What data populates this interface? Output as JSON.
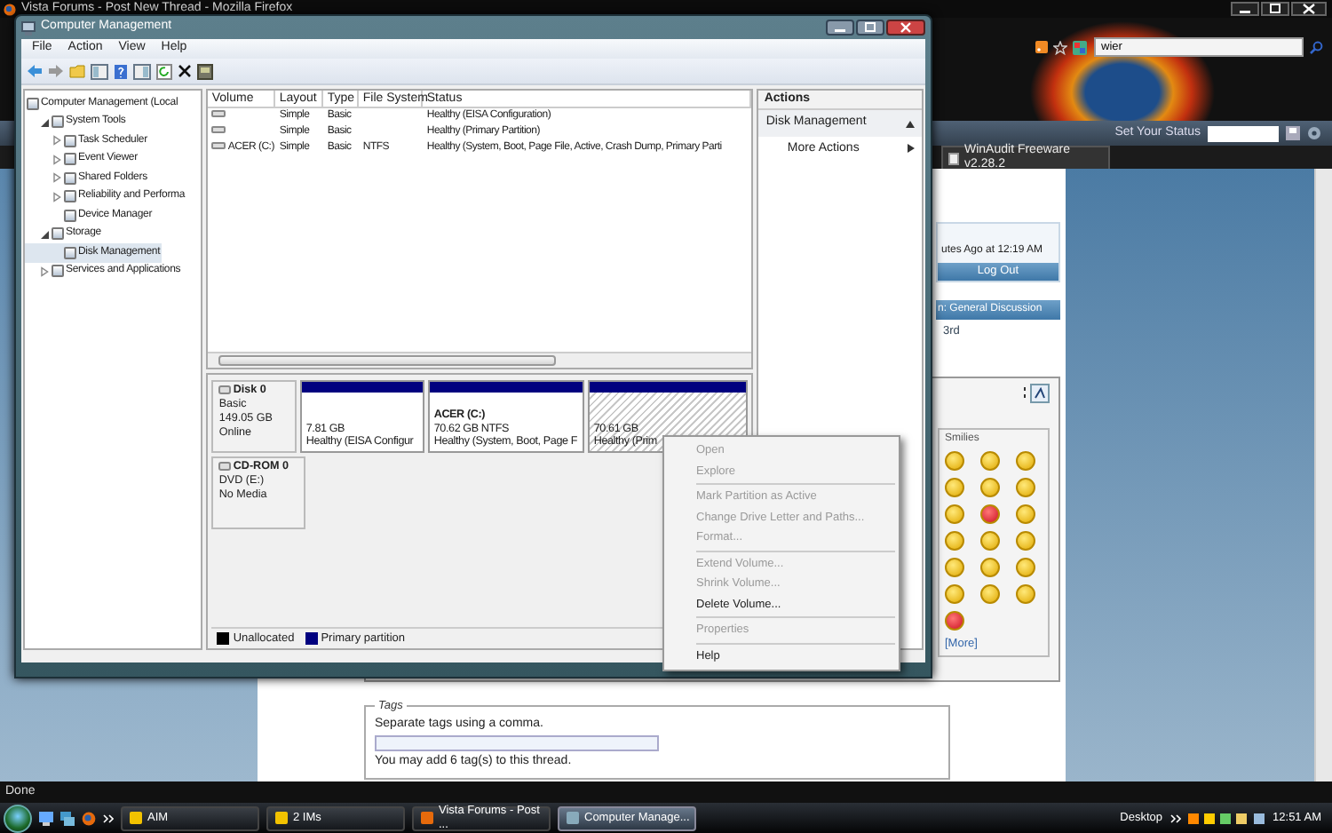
{
  "browser": {
    "title": "Vista Forums - Post New Thread - Mozilla Firefox",
    "search_value": "wier",
    "status_label": "Set Your Status",
    "tab": "WinAudit Freeware v2.28.2",
    "page": {
      "last_visit": "utes Ago at 12:19 AM",
      "logout": "Log Out",
      "forum_bar": "n: General Discussion",
      "text_fragment": "3rd",
      "smilies": {
        "title": "Smilies",
        "more": "[More]"
      },
      "tags": {
        "legend": "Tags",
        "hint": "Separate tags using a comma.",
        "note": "You may add 6 tag(s) to this thread."
      }
    },
    "status_text": "Done"
  },
  "window": {
    "title": "Computer Management",
    "menu": [
      "File",
      "Action",
      "View",
      "Help"
    ],
    "tree": [
      {
        "label": "Computer Management (Local",
        "selected": false,
        "children": [
          {
            "label": "System Tools",
            "expanded": true,
            "selected": false,
            "children": [
              {
                "label": "Task Scheduler",
                "expanded": false,
                "selected": false
              },
              {
                "label": "Event Viewer",
                "expanded": false,
                "selected": false
              },
              {
                "label": "Shared Folders",
                "expanded": false,
                "selected": false
              },
              {
                "label": "Reliability and Performa",
                "expanded": false,
                "selected": false
              },
              {
                "label": "Device Manager",
                "selected": false
              }
            ]
          },
          {
            "label": "Storage",
            "expanded": true,
            "selected": false,
            "children": [
              {
                "label": "Disk Management",
                "selected": true
              }
            ]
          },
          {
            "label": "Services and Applications",
            "expanded": false,
            "selected": false
          }
        ]
      }
    ],
    "table": {
      "columns": [
        "Volume",
        "Layout",
        "Type",
        "File System",
        "Status"
      ],
      "rows": [
        {
          "layout": "Simple",
          "type": "Basic",
          "status": "Healthy (EISA Configuration)"
        },
        {
          "layout": "Simple",
          "type": "Basic",
          "status": "Healthy (Primary Partition)"
        },
        {
          "volume": "ACER (C:)",
          "layout": "Simple",
          "type": "Basic",
          "file_system": "NTFS",
          "status": "Healthy (System, Boot, Page File, Active, Crash Dump, Primary Parti"
        }
      ]
    },
    "disks": [
      {
        "name": "Disk 0",
        "info": [
          "Basic",
          "149.05 GB",
          "Online"
        ],
        "partitions": [
          {
            "size": "7.81 GB",
            "status": "Healthy (EISA Configur",
            "selected": false
          },
          {
            "name": "ACER  (C:)",
            "size": "70.62 GB NTFS",
            "status": "Healthy (System, Boot, Page F",
            "selected": false
          },
          {
            "size": "70.61 GB",
            "status": "Healthy (Prim",
            "selected": true
          }
        ]
      },
      {
        "name": "CD-ROM 0",
        "info": [
          "DVD (E:)",
          "No Media"
        ]
      }
    ],
    "legend": [
      {
        "label": "Unallocated",
        "color": "#000000"
      },
      {
        "label": "Primary partition",
        "color": "#00007f"
      }
    ],
    "actions": {
      "header": "Actions",
      "section": "Disk Management",
      "items": [
        "More Actions"
      ]
    }
  },
  "context_menu": [
    [
      {
        "label": "Open",
        "disabled": true
      },
      {
        "label": "Explore",
        "disabled": true
      }
    ],
    [
      {
        "label": "Mark Partition as Active",
        "disabled": true
      },
      {
        "label": "Change Drive Letter and Paths...",
        "disabled": true
      },
      {
        "label": "Format...",
        "disabled": true
      }
    ],
    [
      {
        "label": "Extend Volume...",
        "disabled": true
      },
      {
        "label": "Shrink Volume...",
        "disabled": true
      },
      {
        "label": "Delete Volume...",
        "disabled": false
      }
    ],
    [
      {
        "label": "Properties",
        "disabled": true
      }
    ],
    [
      {
        "label": "Help",
        "disabled": false
      }
    ]
  ],
  "taskbar": {
    "buttons": [
      {
        "label": "AIM",
        "selected": false
      },
      {
        "label": "2 IMs",
        "selected": false
      },
      {
        "label": "Vista Forums - Post ...",
        "selected": false
      },
      {
        "label": "Computer Manage...",
        "selected": true
      }
    ],
    "tray_label": "Desktop",
    "clock": "12:51 AM"
  }
}
